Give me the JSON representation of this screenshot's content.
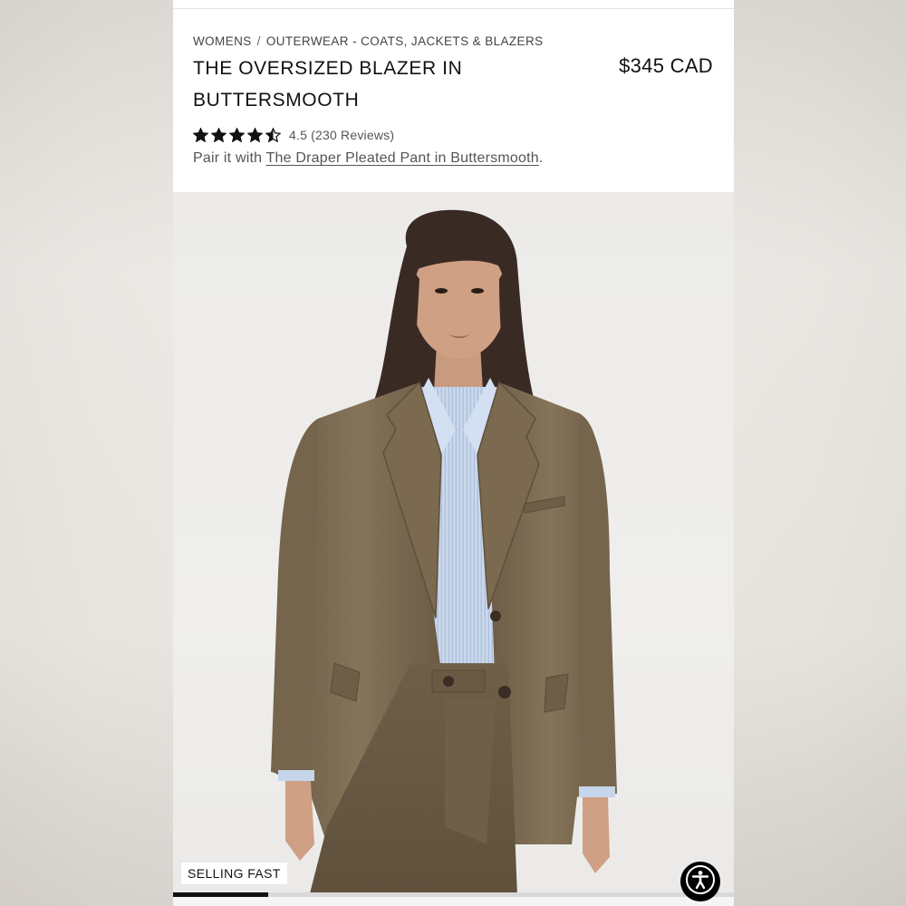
{
  "breadcrumb": {
    "items": [
      "WOMENS",
      "OUTERWEAR - COATS, JACKETS & BLAZERS"
    ],
    "separator": "/"
  },
  "product": {
    "title": "THE OVERSIZED BLAZER IN BUTTERSMOOTH",
    "price": "$345 CAD",
    "rating_text": "4.5 (230 Reviews)",
    "rating_value": 4.5,
    "rating_max": 5,
    "pair_prefix": "Pair it with ",
    "pair_link": "The Draper Pleated Pant in Buttersmooth",
    "pair_suffix": ".",
    "image_alt": "Model wearing olive oversized blazer over light blue striped shirt with matching pleated pants"
  },
  "gallery": {
    "badge": "SELLING FAST",
    "progress_fraction": 0.17
  },
  "icons": {
    "star": "star-icon",
    "accessibility": "accessibility-icon"
  },
  "colors": {
    "blazer": "#7a6a52",
    "shirt": "#c5d5ea",
    "hair": "#3a2a24",
    "text": "#111111"
  }
}
